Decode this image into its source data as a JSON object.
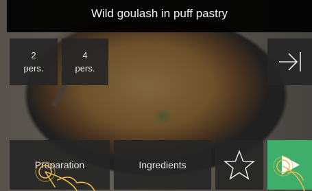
{
  "header": {
    "title": "Wild goulash in puff pastry"
  },
  "servings": [
    {
      "number": "2",
      "unit": "pers."
    },
    {
      "number": "4",
      "unit": "pers."
    }
  ],
  "bottom_bar": {
    "preparation_label": "Preparation",
    "ingredients_label": "Ingredients"
  },
  "icons": {
    "next": "skip-forward-icon",
    "favorite": "star-icon",
    "start": "play-icon",
    "gesture": "hand-tap-icon"
  },
  "colors": {
    "tile_bg": "#262626",
    "start_accent": "#3fae6b",
    "gesture_stroke": "#e8b84a",
    "text": "#e8e8e8"
  }
}
